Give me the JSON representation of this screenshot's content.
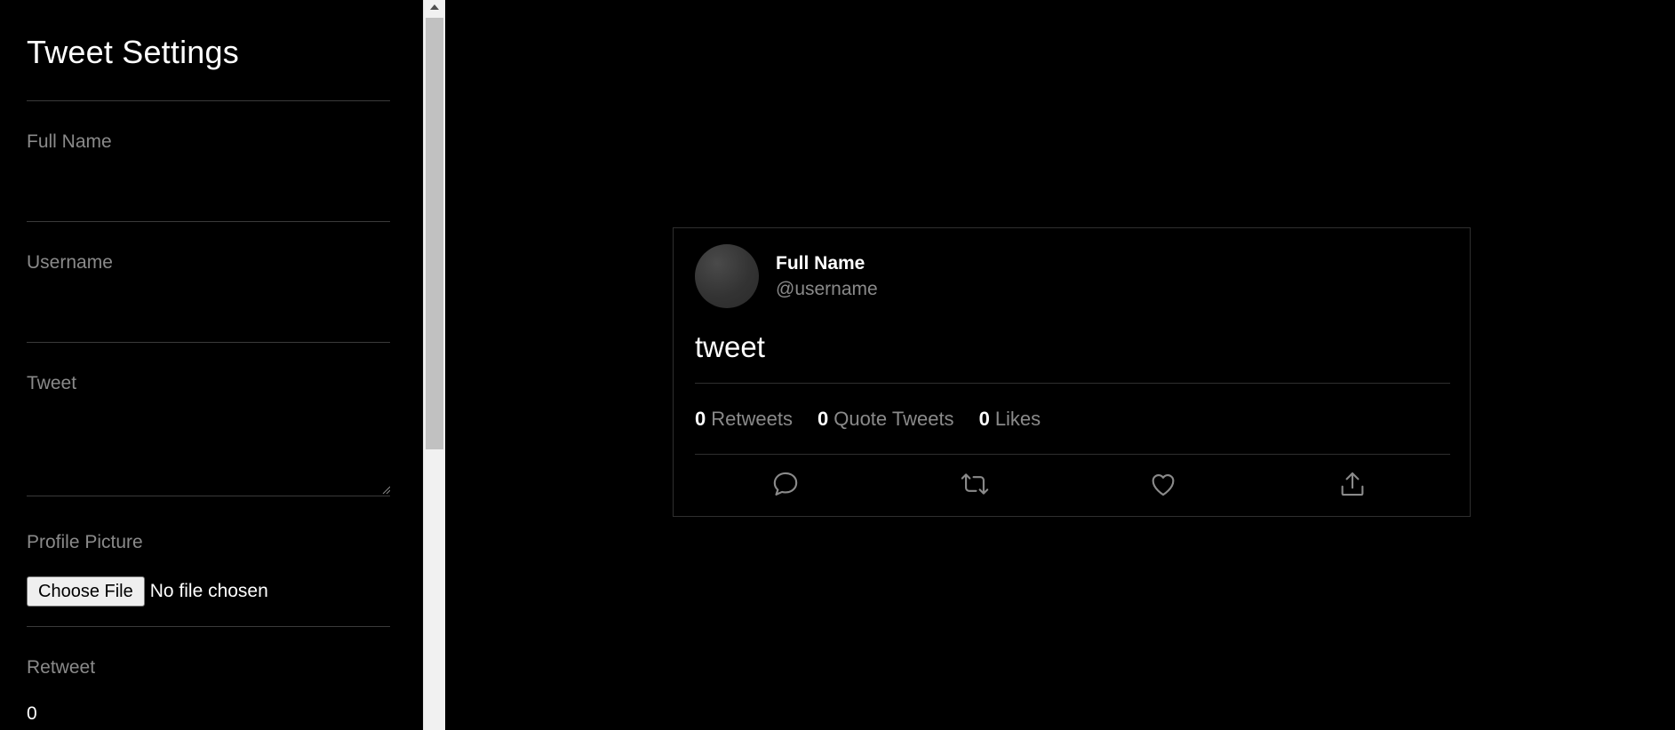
{
  "settings": {
    "title": "Tweet Settings",
    "full_name_label": "Full Name",
    "full_name_value": "",
    "username_label": "Username",
    "username_value": "",
    "tweet_label": "Tweet",
    "tweet_value": "",
    "profile_picture_label": "Profile Picture",
    "choose_file_label": "Choose File",
    "file_status": "No file chosen",
    "retweet_label": "Retweet",
    "retweet_value": "0"
  },
  "tweet": {
    "display_name": "Full Name",
    "handle": "@username",
    "text": "tweet",
    "stats": {
      "retweets_count": "0",
      "retweets_label": "Retweets",
      "quotes_count": "0",
      "quotes_label": "Quote Tweets",
      "likes_count": "0",
      "likes_label": "Likes"
    },
    "actions": [
      "reply-icon",
      "retweet-icon",
      "like-icon",
      "share-icon"
    ]
  },
  "colors": {
    "background": "#000000",
    "text": "#ffffff",
    "muted": "#8a8a8a",
    "divider": "#2f2f2f",
    "scrollbar_track": "#f1f1f1",
    "scrollbar_thumb": "#c1c1c1"
  }
}
